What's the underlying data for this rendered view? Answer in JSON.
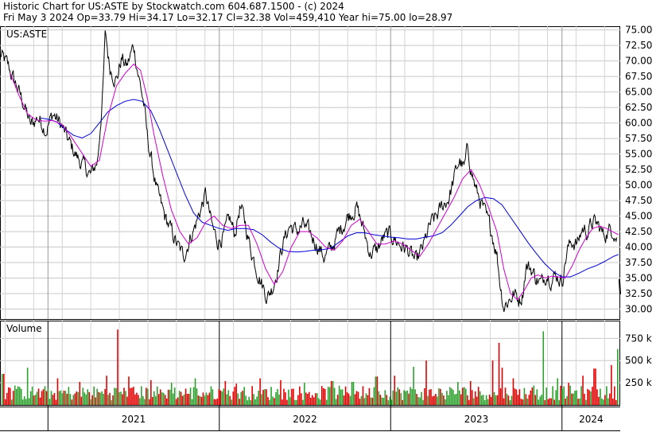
{
  "header": {
    "line1": "Historic Chart for US:ASTE by Stockwatch.com 604.687.1500 - (c) 2024",
    "line2": "Fri May  3 2024   Op=33.79   Hi=34.17   Lo=32.17   Cl=32.38   Vol=459,410   Year hi=75.00   lo=28.97"
  },
  "chart_data": {
    "type": "line",
    "symbol_label": "US:ASTE",
    "volume_label": "Volume",
    "price_axis": {
      "ylim": [
        28.4,
        75.6
      ],
      "ticks": [
        30.0,
        32.5,
        35.0,
        37.5,
        40.0,
        42.5,
        45.0,
        47.5,
        50.0,
        52.5,
        55.0,
        57.5,
        60.0,
        62.5,
        65.0,
        67.5,
        70.0,
        72.5,
        75.0
      ],
      "tick_labels": [
        "30.00",
        "32.50",
        "35.00",
        "37.50",
        "40.00",
        "42.50",
        "45.00",
        "47.50",
        "50.00",
        "52.50",
        "55.00",
        "57.50",
        "60.00",
        "62.50",
        "65.00",
        "67.50",
        "70.00",
        "72.50",
        "75.00"
      ]
    },
    "volume_axis": {
      "ylim": [
        0,
        950000
      ],
      "ticks": [
        250000,
        500000,
        750000
      ],
      "tick_labels": [
        "250 k",
        "500 k",
        "750 k"
      ]
    },
    "x_axis": {
      "range": [
        2020.72,
        2024.34
      ],
      "year_labels": [
        {
          "label": "2021",
          "center": 2021.5
        },
        {
          "label": "2022",
          "center": 2022.5
        },
        {
          "label": "2023",
          "center": 2023.5
        },
        {
          "label": "2024",
          "center": 2024.17
        }
      ],
      "year_boundaries": [
        2021.0,
        2022.0,
        2023.0,
        2024.0
      ]
    },
    "grid": true,
    "price_keypoints": [
      [
        2020.72,
        71.0
      ],
      [
        2020.76,
        69.5
      ],
      [
        2020.8,
        67.0
      ],
      [
        2020.86,
        63.0
      ],
      [
        2020.9,
        59.5
      ],
      [
        2020.94,
        61.0
      ],
      [
        2020.99,
        59.0
      ],
      [
        2021.03,
        61.5
      ],
      [
        2021.08,
        59.5
      ],
      [
        2021.12,
        57.0
      ],
      [
        2021.17,
        54.5
      ],
      [
        2021.21,
        53.0
      ],
      [
        2021.25,
        51.5
      ],
      [
        2021.29,
        54.0
      ],
      [
        2021.32,
        65.0
      ],
      [
        2021.335,
        74.5
      ],
      [
        2021.36,
        69.0
      ],
      [
        2021.4,
        67.0
      ],
      [
        2021.43,
        70.5
      ],
      [
        2021.46,
        69.0
      ],
      [
        2021.5,
        72.5
      ],
      [
        2021.53,
        67.5
      ],
      [
        2021.56,
        63.0
      ],
      [
        2021.58,
        57.5
      ],
      [
        2021.61,
        53.0
      ],
      [
        2021.64,
        48.5
      ],
      [
        2021.68,
        45.0
      ],
      [
        2021.72,
        42.5
      ],
      [
        2021.76,
        40.0
      ],
      [
        2021.79,
        38.5
      ],
      [
        2021.83,
        41.5
      ],
      [
        2021.86,
        43.5
      ],
      [
        2021.89,
        46.0
      ],
      [
        2021.92,
        48.5
      ],
      [
        2021.96,
        43.0
      ],
      [
        2021.99,
        41.0
      ],
      [
        2022.03,
        42.0
      ],
      [
        2022.06,
        44.5
      ],
      [
        2022.09,
        42.0
      ],
      [
        2022.12,
        46.5
      ],
      [
        2022.15,
        44.0
      ],
      [
        2022.18,
        40.0
      ],
      [
        2022.22,
        36.5
      ],
      [
        2022.25,
        34.0
      ],
      [
        2022.28,
        32.0
      ],
      [
        2022.31,
        33.5
      ],
      [
        2022.34,
        36.5
      ],
      [
        2022.37,
        40.5
      ],
      [
        2022.41,
        43.5
      ],
      [
        2022.45,
        42.5
      ],
      [
        2022.49,
        43.5
      ],
      [
        2022.53,
        42.0
      ],
      [
        2022.57,
        40.5
      ],
      [
        2022.61,
        38.5
      ],
      [
        2022.65,
        39.5
      ],
      [
        2022.7,
        42.5
      ],
      [
        2022.75,
        45.0
      ],
      [
        2022.8,
        46.5
      ],
      [
        2022.84,
        43.0
      ],
      [
        2022.88,
        39.0
      ],
      [
        2022.92,
        39.5
      ],
      [
        2022.96,
        41.5
      ],
      [
        2023.0,
        42.0
      ],
      [
        2023.05,
        40.5
      ],
      [
        2023.1,
        39.5
      ],
      [
        2023.15,
        37.5
      ],
      [
        2023.19,
        40.0
      ],
      [
        2023.23,
        43.5
      ],
      [
        2023.27,
        45.0
      ],
      [
        2023.3,
        46.5
      ],
      [
        2023.34,
        48.0
      ],
      [
        2023.37,
        51.0
      ],
      [
        2023.4,
        54.0
      ],
      [
        2023.43,
        52.5
      ],
      [
        2023.45,
        56.0
      ],
      [
        2023.47,
        52.5
      ],
      [
        2023.5,
        49.0
      ],
      [
        2023.53,
        47.0
      ],
      [
        2023.56,
        44.5
      ],
      [
        2023.59,
        42.5
      ],
      [
        2023.62,
        39.0
      ],
      [
        2023.64,
        34.0
      ],
      [
        2023.66,
        30.5
      ],
      [
        2023.69,
        31.5
      ],
      [
        2023.72,
        32.5
      ],
      [
        2023.75,
        31.5
      ],
      [
        2023.77,
        32.5
      ],
      [
        2023.79,
        37.0
      ],
      [
        2023.82,
        36.5
      ],
      [
        2023.85,
        35.0
      ],
      [
        2023.88,
        34.0
      ],
      [
        2023.91,
        36.0
      ],
      [
        2023.94,
        35.0
      ],
      [
        2023.97,
        35.5
      ],
      [
        2024.0,
        34.5
      ],
      [
        2024.03,
        39.5
      ],
      [
        2024.06,
        41.0
      ],
      [
        2024.09,
        40.5
      ],
      [
        2024.12,
        43.0
      ],
      [
        2024.15,
        42.5
      ],
      [
        2024.18,
        44.0
      ],
      [
        2024.21,
        43.5
      ],
      [
        2024.24,
        42.0
      ],
      [
        2024.27,
        42.5
      ],
      [
        2024.3,
        43.0
      ],
      [
        2024.32,
        41.5
      ]
    ],
    "price_tail_segment": [
      [
        2024.335,
        34.8
      ],
      [
        2024.34,
        32.4
      ]
    ],
    "ma_short": {
      "color": "#d000d0",
      "points": [
        [
          2020.78,
          68.0
        ],
        [
          2020.83,
          64.5
        ],
        [
          2020.88,
          61.5
        ],
        [
          2020.93,
          60.5
        ],
        [
          2020.98,
          60.3
        ],
        [
          2021.03,
          60.4
        ],
        [
          2021.08,
          59.8
        ],
        [
          2021.13,
          58.0
        ],
        [
          2021.19,
          55.5
        ],
        [
          2021.25,
          53.0
        ],
        [
          2021.3,
          54.0
        ],
        [
          2021.35,
          61.0
        ],
        [
          2021.4,
          66.0
        ],
        [
          2021.45,
          68.0
        ],
        [
          2021.5,
          69.5
        ],
        [
          2021.54,
          68.5
        ],
        [
          2021.58,
          64.0
        ],
        [
          2021.62,
          58.0
        ],
        [
          2021.67,
          51.5
        ],
        [
          2021.72,
          46.0
        ],
        [
          2021.77,
          42.5
        ],
        [
          2021.82,
          40.5
        ],
        [
          2021.87,
          41.5
        ],
        [
          2021.92,
          44.0
        ],
        [
          2021.97,
          45.0
        ],
        [
          2022.02,
          43.5
        ],
        [
          2022.07,
          43.0
        ],
        [
          2022.12,
          43.5
        ],
        [
          2022.17,
          43.5
        ],
        [
          2022.22,
          40.5
        ],
        [
          2022.27,
          36.5
        ],
        [
          2022.32,
          34.0
        ],
        [
          2022.37,
          36.0
        ],
        [
          2022.42,
          40.0
        ],
        [
          2022.47,
          42.5
        ],
        [
          2022.52,
          42.5
        ],
        [
          2022.57,
          41.5
        ],
        [
          2022.62,
          40.0
        ],
        [
          2022.67,
          39.5
        ],
        [
          2022.72,
          41.0
        ],
        [
          2022.77,
          43.5
        ],
        [
          2022.82,
          44.5
        ],
        [
          2022.87,
          42.5
        ],
        [
          2022.92,
          40.5
        ],
        [
          2022.97,
          40.5
        ],
        [
          2023.02,
          41.0
        ],
        [
          2023.07,
          40.5
        ],
        [
          2023.12,
          39.5
        ],
        [
          2023.17,
          38.5
        ],
        [
          2023.22,
          40.5
        ],
        [
          2023.27,
          43.0
        ],
        [
          2023.32,
          45.5
        ],
        [
          2023.37,
          48.0
        ],
        [
          2023.42,
          51.0
        ],
        [
          2023.47,
          52.5
        ],
        [
          2023.52,
          50.0
        ],
        [
          2023.57,
          46.5
        ],
        [
          2023.62,
          42.5
        ],
        [
          2023.66,
          36.5
        ],
        [
          2023.7,
          32.5
        ],
        [
          2023.74,
          31.5
        ],
        [
          2023.78,
          33.0
        ],
        [
          2023.82,
          35.0
        ],
        [
          2023.86,
          35.5
        ],
        [
          2023.9,
          35.0
        ],
        [
          2023.94,
          35.3
        ],
        [
          2023.98,
          35.2
        ],
        [
          2024.02,
          35.0
        ],
        [
          2024.06,
          37.0
        ],
        [
          2024.1,
          39.5
        ],
        [
          2024.14,
          41.5
        ],
        [
          2024.18,
          43.0
        ],
        [
          2024.22,
          43.4
        ],
        [
          2024.26,
          43.0
        ],
        [
          2024.3,
          42.4
        ],
        [
          2024.33,
          42.0
        ]
      ]
    },
    "ma_long": {
      "color": "#0000d8",
      "points": [
        [
          2020.96,
          60.8
        ],
        [
          2021.0,
          60.6
        ],
        [
          2021.05,
          60.2
        ],
        [
          2021.1,
          59.0
        ],
        [
          2021.15,
          58.0
        ],
        [
          2021.2,
          57.6
        ],
        [
          2021.25,
          58.3
        ],
        [
          2021.3,
          60.0
        ],
        [
          2021.35,
          61.8
        ],
        [
          2021.4,
          62.8
        ],
        [
          2021.45,
          63.5
        ],
        [
          2021.5,
          63.8
        ],
        [
          2021.55,
          63.5
        ],
        [
          2021.6,
          62.0
        ],
        [
          2021.65,
          59.0
        ],
        [
          2021.7,
          55.5
        ],
        [
          2021.75,
          52.0
        ],
        [
          2021.8,
          48.5
        ],
        [
          2021.85,
          45.5
        ],
        [
          2021.9,
          44.0
        ],
        [
          2021.95,
          43.5
        ],
        [
          2022.0,
          43.0
        ],
        [
          2022.05,
          42.7
        ],
        [
          2022.1,
          43.0
        ],
        [
          2022.15,
          43.0
        ],
        [
          2022.2,
          42.8
        ],
        [
          2022.25,
          42.0
        ],
        [
          2022.3,
          40.8
        ],
        [
          2022.35,
          39.8
        ],
        [
          2022.4,
          39.3
        ],
        [
          2022.45,
          39.2
        ],
        [
          2022.5,
          39.3
        ],
        [
          2022.55,
          39.5
        ],
        [
          2022.6,
          39.6
        ],
        [
          2022.65,
          39.8
        ],
        [
          2022.7,
          40.8
        ],
        [
          2022.75,
          41.8
        ],
        [
          2022.8,
          42.3
        ],
        [
          2022.85,
          42.3
        ],
        [
          2022.9,
          42.0
        ],
        [
          2022.95,
          41.8
        ],
        [
          2023.0,
          41.6
        ],
        [
          2023.05,
          41.5
        ],
        [
          2023.1,
          41.3
        ],
        [
          2023.15,
          41.3
        ],
        [
          2023.2,
          41.6
        ],
        [
          2023.25,
          41.8
        ],
        [
          2023.3,
          42.3
        ],
        [
          2023.35,
          43.5
        ],
        [
          2023.4,
          45.0
        ],
        [
          2023.45,
          46.5
        ],
        [
          2023.5,
          47.5
        ],
        [
          2023.55,
          48.0
        ],
        [
          2023.6,
          47.8
        ],
        [
          2023.65,
          46.8
        ],
        [
          2023.7,
          44.8
        ],
        [
          2023.75,
          42.8
        ],
        [
          2023.8,
          40.8
        ],
        [
          2023.85,
          39.0
        ],
        [
          2023.9,
          37.3
        ],
        [
          2023.95,
          36.0
        ],
        [
          2024.0,
          35.2
        ],
        [
          2024.05,
          35.2
        ],
        [
          2024.1,
          35.8
        ],
        [
          2024.15,
          36.5
        ],
        [
          2024.2,
          37.0
        ],
        [
          2024.25,
          37.7
        ],
        [
          2024.3,
          38.5
        ],
        [
          2024.33,
          38.8
        ]
      ]
    },
    "volume_series": {
      "base_level": 150000,
      "spikes": [
        [
          2020.73,
          350000
        ],
        [
          2020.8,
          220000
        ],
        [
          2020.87,
          420000
        ],
        [
          2021.05,
          300000
        ],
        [
          2021.18,
          260000
        ],
        [
          2021.34,
          330000
        ],
        [
          2021.4,
          850000
        ],
        [
          2021.47,
          320000
        ],
        [
          2021.6,
          280000
        ],
        [
          2021.72,
          250000
        ],
        [
          2021.86,
          300000
        ],
        [
          2022.03,
          270000
        ],
        [
          2022.1,
          240000
        ],
        [
          2022.24,
          300000
        ],
        [
          2022.36,
          280000
        ],
        [
          2022.5,
          250000
        ],
        [
          2022.66,
          270000
        ],
        [
          2022.78,
          260000
        ],
        [
          2022.92,
          320000
        ],
        [
          2023.03,
          330000
        ],
        [
          2023.14,
          430000
        ],
        [
          2023.21,
          500000
        ],
        [
          2023.4,
          260000
        ],
        [
          2023.47,
          270000
        ],
        [
          2023.6,
          500000
        ],
        [
          2023.64,
          700000
        ],
        [
          2023.66,
          420000
        ],
        [
          2023.72,
          300000
        ],
        [
          2023.84,
          220000
        ],
        [
          2023.9,
          830000
        ],
        [
          2023.98,
          300000
        ],
        [
          2024.05,
          250000
        ],
        [
          2024.13,
          330000
        ],
        [
          2024.2,
          410000
        ],
        [
          2024.3,
          450000
        ],
        [
          2024.332,
          630000
        ],
        [
          2024.338,
          460000
        ]
      ]
    }
  },
  "colors": {
    "price": "#000000",
    "ma_short": "#d000d0",
    "ma_long": "#0000d8",
    "volume_up": "#2ca02c",
    "volume_down": "#e00000",
    "grid": "#c8c8c8"
  }
}
